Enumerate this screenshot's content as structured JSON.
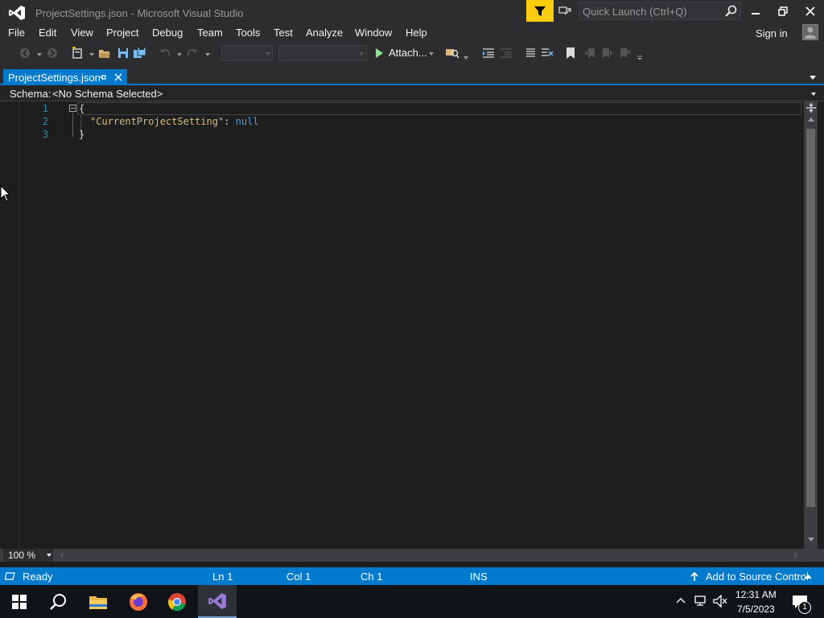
{
  "window": {
    "title": "ProjectSettings.json - Microsoft Visual Studio"
  },
  "quick_launch": {
    "placeholder": "Quick Launch (Ctrl+Q)"
  },
  "menu": {
    "items": [
      "File",
      "Edit",
      "View",
      "Project",
      "Debug",
      "Team",
      "Tools",
      "Test",
      "Analyze",
      "Window",
      "Help"
    ],
    "sign_in": "Sign in"
  },
  "toolbar": {
    "attach_label": "Attach..."
  },
  "tab": {
    "label": "ProjectSettings.json"
  },
  "schema": {
    "label": "Schema:",
    "value": "<No Schema Selected>"
  },
  "editor": {
    "line_numbers": [
      "1",
      "2",
      "3"
    ],
    "lines": {
      "open_brace": "{",
      "key": "\"CurrentProjectSetting\"",
      "colon": ": ",
      "value": "null",
      "close_brace": "}"
    }
  },
  "zoom": {
    "value": "100 %"
  },
  "status": {
    "ready": "Ready",
    "ln": "Ln 1",
    "col": "Col 1",
    "ch": "Ch 1",
    "mode": "INS",
    "source_control": "Add to Source Control"
  },
  "taskbar": {
    "time": "12:31 AM",
    "date": "7/5/2023",
    "notification_count": "1"
  },
  "colors": {
    "accent": "#007acc",
    "json_key": "#d7ba7d",
    "json_null": "#569cd6",
    "line_number": "#2b91af",
    "feedback": "#fccc11"
  }
}
